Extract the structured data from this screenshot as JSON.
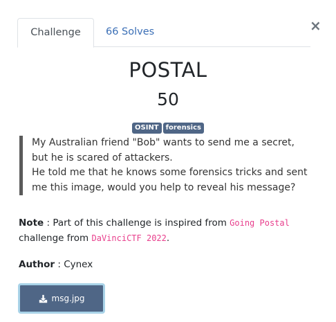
{
  "tabs": {
    "challenge_label": "Challenge",
    "solves_label": "66 Solves"
  },
  "close_glyph": "×",
  "challenge": {
    "name": "POSTAL",
    "points": "50",
    "tags": [
      "OSINT",
      "forensics"
    ],
    "description_lines": [
      "My Australian friend \"Bob\" wants to send me a secret,",
      "but he is scared of attackers.",
      "He told me that he knows some forensics tricks and sent",
      "me this image, would you help to reveal his message?"
    ]
  },
  "note": {
    "label": "Note",
    "sep": " : ",
    "text1": "Part of this challenge is inspired from ",
    "code1": "Going Postal",
    "text2": "challenge from ",
    "code2": "DaVinciCTF 2022",
    "text3": "."
  },
  "author": {
    "label": "Author",
    "sep": " : ",
    "name": "Cynex"
  },
  "download": {
    "icon": "download-icon",
    "label": "msg.jpg"
  },
  "colors": {
    "accent": "#4f6686",
    "link": "#3b6fb6",
    "code": "#e83e8c"
  }
}
